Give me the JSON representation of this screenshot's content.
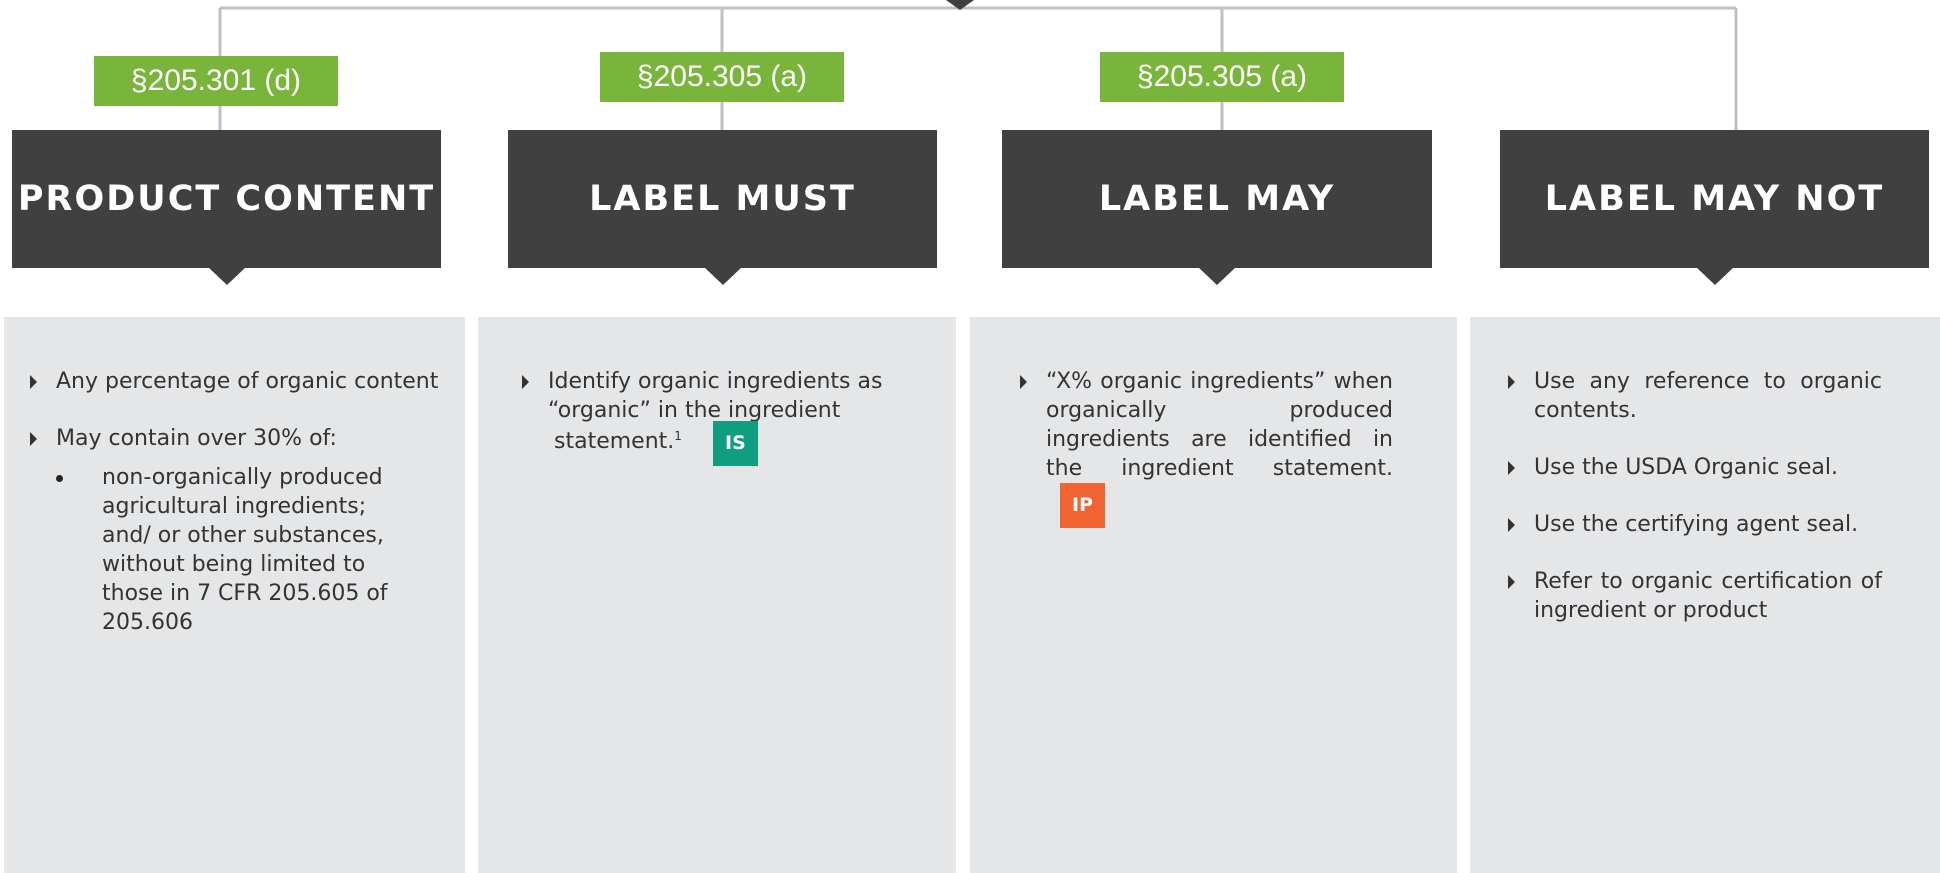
{
  "columns": [
    {
      "ref": "§205.301 (d)",
      "header": "Product Content",
      "items": [
        {
          "text": "Any percentage of organic content"
        },
        {
          "text": "May contain over 30% of:",
          "subitems": [
            "non-organically produced agricultural ingredients; and/ or other substances, without being limited to those in 7 CFR 205.605 of 205.606"
          ]
        }
      ]
    },
    {
      "ref": "§205.305 (a)",
      "header": "Label Must",
      "items": [
        {
          "text_line1": "Identify organic ingredients as",
          "text_line2": "“organic” in the ingredient",
          "text_line3": "statement.",
          "footnote": "1",
          "badge": "IS"
        }
      ]
    },
    {
      "ref": "§205.305 (a)",
      "header": "Label May",
      "items": [
        {
          "text": "“X% organic ingredients” when organically produced ingredients are identified in the ingredient statement.",
          "badge": "IP"
        }
      ]
    },
    {
      "ref": "",
      "header": "Label May Not",
      "items": [
        {
          "text": "Use any reference to organic contents."
        },
        {
          "text": "Use the USDA Organic seal."
        },
        {
          "text": "Use the certifying agent seal."
        },
        {
          "text": "Refer to organic certification of ingredient or product"
        }
      ]
    }
  ],
  "colors": {
    "ref_tag": "#79b53a",
    "header": "#404040",
    "panel": "#e5e6e8",
    "connector": "#c0c0c0",
    "badge_is": "#0f9e80",
    "badge_ip": "#f26332"
  }
}
